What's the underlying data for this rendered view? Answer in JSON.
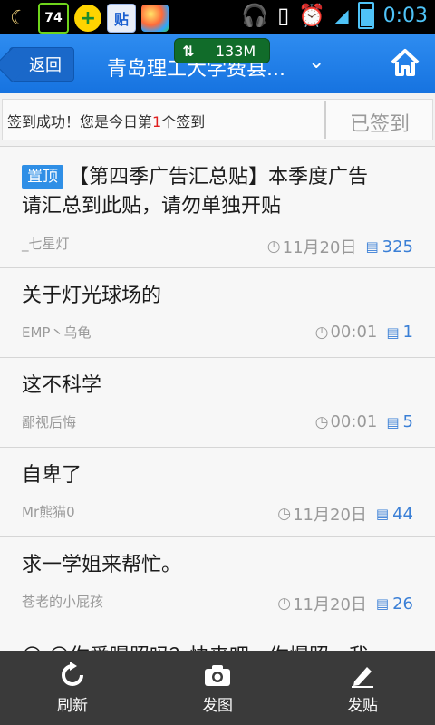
{
  "status_bar": {
    "battery_num": "74",
    "tie_label": "贴",
    "time": "0:03",
    "net_speed": "133M"
  },
  "header": {
    "back_label": "返回",
    "forum_title": "青岛理工大学费县..."
  },
  "signin": {
    "message_pre": "签到成功！您是今日第",
    "rank": "1",
    "message_post": "个签到",
    "button_label": "已签到"
  },
  "posts": [
    {
      "pinned": true,
      "pin_label": "置顶",
      "title_line1": "【第四季广告汇总贴】本季度广告",
      "title_line2": "请汇总到此贴，请勿单独开贴",
      "author": "_七星灯",
      "time": "11月20日",
      "replies": "325"
    },
    {
      "title_line1": "关于灯光球场的",
      "author": "EMP丶乌龟",
      "time": "00:01",
      "replies": "1"
    },
    {
      "title_line1": "这不科学",
      "author": "鄙视后悔",
      "time": "00:01",
      "replies": "5"
    },
    {
      "title_line1": "自卑了",
      "author": "Mr熊猫0",
      "time": "11月20日",
      "replies": "44"
    },
    {
      "title_line1": "求一学姐来帮忙。",
      "author": "苍老的小屁孩",
      "time": "11月20日",
      "replies": "26"
    }
  ],
  "partial_post": "☺ ☺你爱曝照吗？快来吧，你爆照，我",
  "bottom_bar": {
    "refresh": "刷新",
    "photo": "发图",
    "post": "发贴"
  }
}
